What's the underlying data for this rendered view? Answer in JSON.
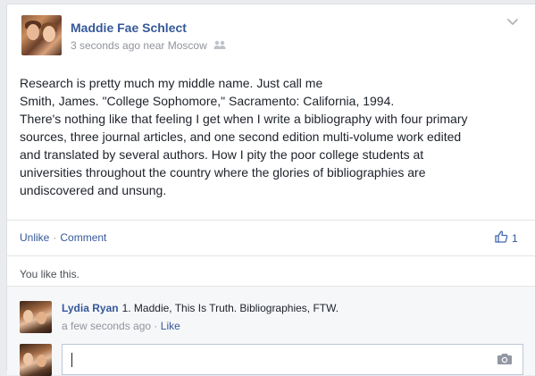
{
  "post": {
    "author": "Maddie Fae Schlect",
    "timestamp": "3 seconds ago near Moscow",
    "body_lines": [
      "Research is pretty much my middle name. Just call me",
      "Smith, James. \"College Sophomore,\" Sacramento: California, 1994.",
      "There's nothing like that feeling I get when I write a bibliography with four primary",
      "sources, three journal articles, and one second edition multi-volume work edited",
      "and translated by several authors. How I pity the poor college students at",
      "universities throughout the country where the glories of bibliographies are",
      "undiscovered and unsung."
    ],
    "actions": {
      "unlike_label": "Unlike",
      "separator": "·",
      "comment_label": "Comment",
      "like_count": "1"
    },
    "likes_summary": "You like this."
  },
  "comments": [
    {
      "author": "Lydia Ryan",
      "text": "1. Maddie, This Is Truth. Bibliographies, FTW.",
      "timestamp": "a few seconds ago",
      "separator": "·",
      "like_label": "Like"
    }
  ],
  "composer": {
    "value": ""
  },
  "icons": {
    "audience": "people-icon",
    "options": "chevron-down-icon",
    "like": "thumbs-up-icon",
    "attach_photo": "camera-icon"
  },
  "colors": {
    "link": "#365899",
    "meta": "#90949c",
    "text": "#1d2129"
  }
}
